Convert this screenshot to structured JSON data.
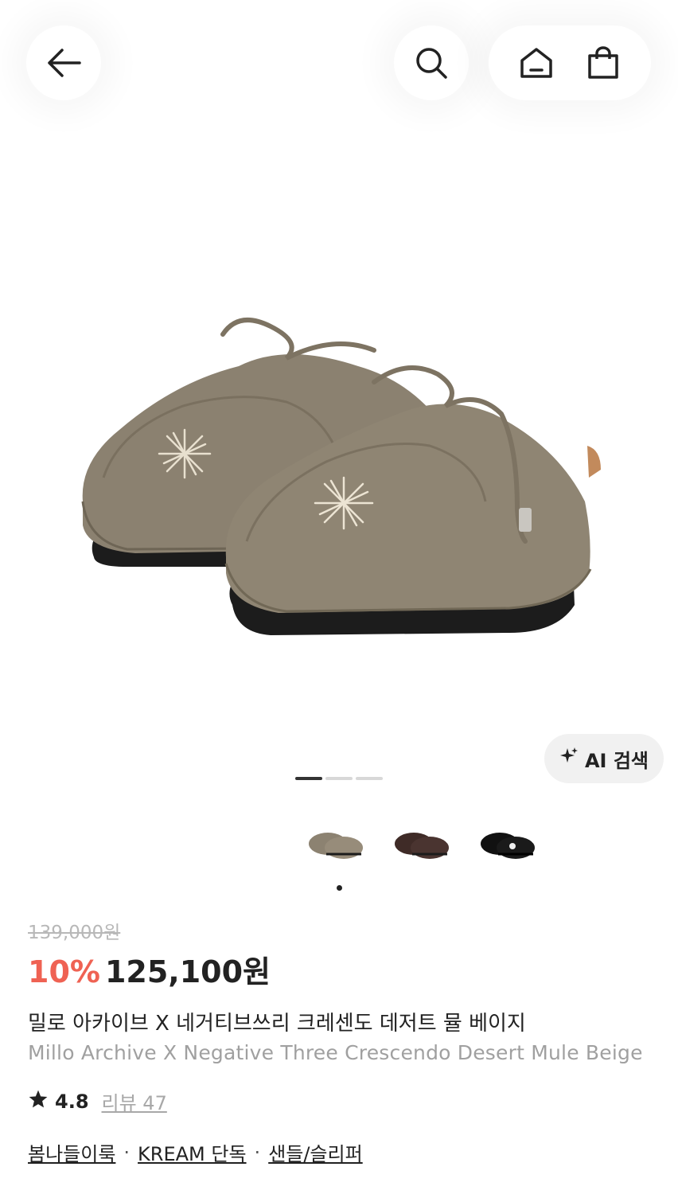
{
  "header": {
    "back_icon": "arrow-left-icon",
    "search_icon": "search-icon",
    "home_icon": "home-icon",
    "bag_icon": "shopping-bag-icon"
  },
  "gallery": {
    "ai_search_label": "AI 검색",
    "ai_icon": "sparkle-icon",
    "page_count": 3,
    "active_page": 1
  },
  "colors": {
    "discount": "#ef6253",
    "beige": "#8c8271",
    "brown": "#4a3430",
    "black": "#1a1a1a"
  },
  "product": {
    "original_price": "139,000원",
    "discount": "10%",
    "price": "125,100원",
    "title_ko": "밀로 아카이브 X 네거티브쓰리 크레센도 데저트 뮬 베이지",
    "title_en": "Millo Archive X Negative Three Crescendo Desert Mule Beige",
    "rating": "4.8",
    "review_label": "리뷰 47",
    "tags": [
      "봄나들이룩",
      "KREAM 단독",
      "샌들/슬리퍼"
    ],
    "tag_separator": "·"
  }
}
